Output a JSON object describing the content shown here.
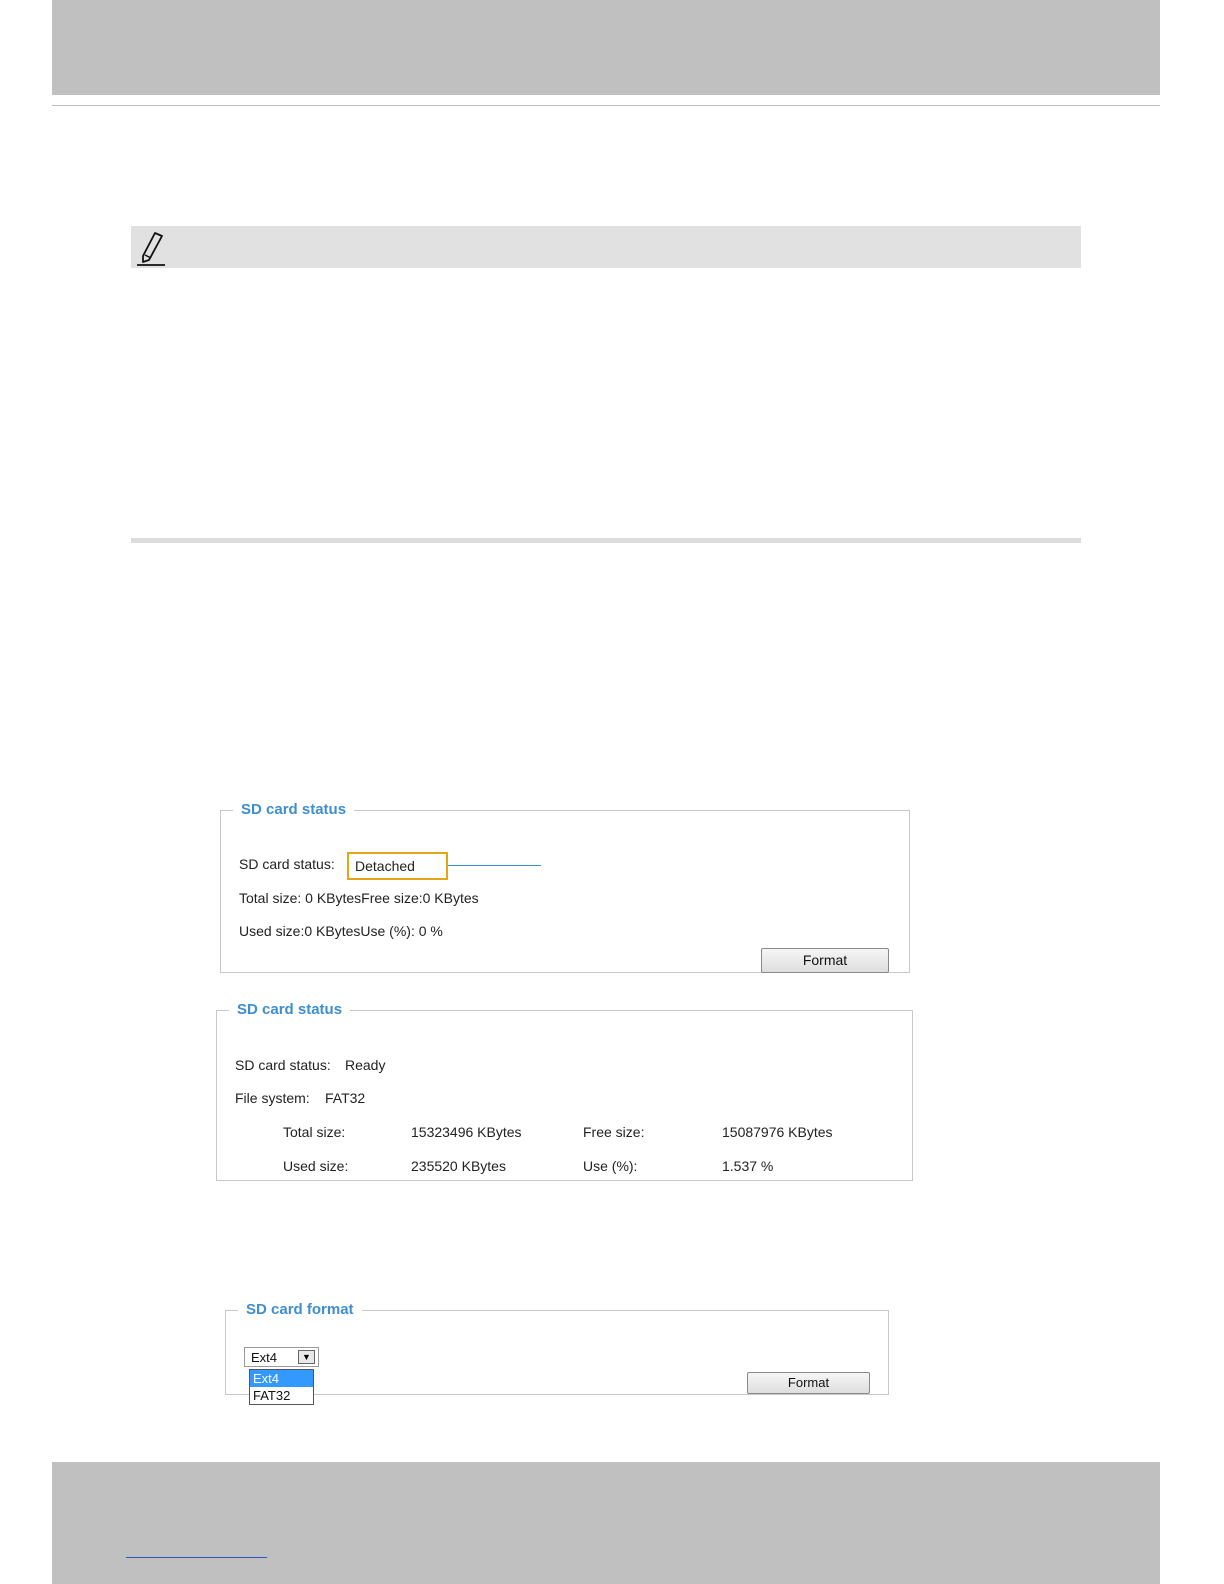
{
  "note": {
    "icon": "pencil-icon"
  },
  "sd_status_detached": {
    "legend": "SD card status",
    "status_label": "SD card status:",
    "status_value": "Detached",
    "size_line": "Total size: 0  KBytesFree size:0  KBytes",
    "used_line": "Used size:0  KBytesUse (%):  0 %",
    "format_button": "Format",
    "highlight_color": "#e6a514",
    "callout_color": "#3a8fd0"
  },
  "sd_status_ready": {
    "legend": "SD card status",
    "status_label": "SD card status:",
    "status_value": "Ready",
    "fs_label": "File system:",
    "fs_value": "FAT32",
    "total_label": "Total size:",
    "total_value": "15323496  KBytes",
    "free_label": "Free size:",
    "free_value": "15087976  KBytes",
    "used_label": "Used size:",
    "used_value": "235520  KBytes",
    "use_pct_label": "Use (%):",
    "use_pct_value": "1.537 %"
  },
  "sd_format": {
    "legend": "SD card format",
    "selected": "Ext4",
    "options": [
      "Ext4",
      "FAT32"
    ],
    "format_button": "Format",
    "highlight_color": "#3399ff"
  },
  "legend_color": "#3e8ed0"
}
